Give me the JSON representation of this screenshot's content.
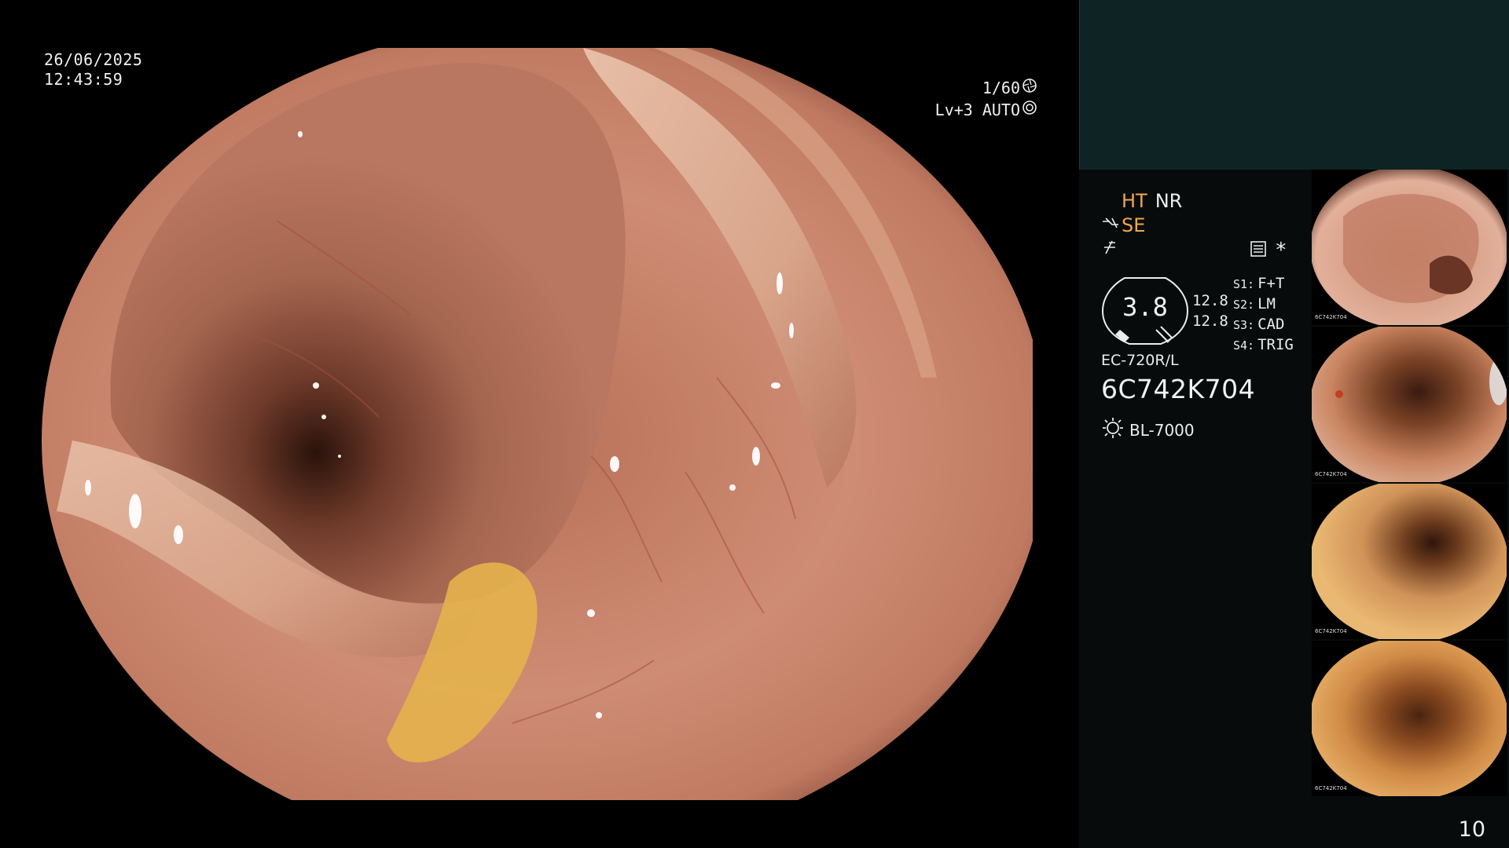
{
  "overlay": {
    "date": "26/06/2025",
    "time": "12:43:59",
    "shutter": "1/60",
    "level": "Lv+3",
    "exposure_mode": "AUTO"
  },
  "status": {
    "mode_ht": "HT",
    "mode_nr": "NR",
    "mode_se": "SE",
    "gauge_value": "3.8",
    "gauge_side_top": "12.8",
    "gauge_side_bottom": "12.8",
    "switches": [
      {
        "key": "S1:",
        "value": "F+T"
      },
      {
        "key": "S2:",
        "value": "LM"
      },
      {
        "key": "S3:",
        "value": "CAD"
      },
      {
        "key": "S4:",
        "value": "TRIG"
      }
    ],
    "scope_model": "EC-720R/L",
    "scope_serial": "6C742K704",
    "light_source": "BL-7000"
  },
  "thumbnails": [
    {
      "serial": "6C742K704"
    },
    {
      "serial": "6C742K704"
    },
    {
      "serial": "6C742K704"
    },
    {
      "serial": "6C742K704"
    }
  ],
  "page_number": "10",
  "colors": {
    "panel_top": "#0e2324",
    "panel": "#070b0c",
    "accent_orange": "#f0a84a",
    "mucosa": "#c98570"
  },
  "icons": {
    "shutter": "aperture-icon",
    "auto": "auto-exposure-icon",
    "light": "light-source-icon",
    "structure": "structure-enhance-icon",
    "color": "color-enhance-icon",
    "memo": "memo-icon"
  }
}
